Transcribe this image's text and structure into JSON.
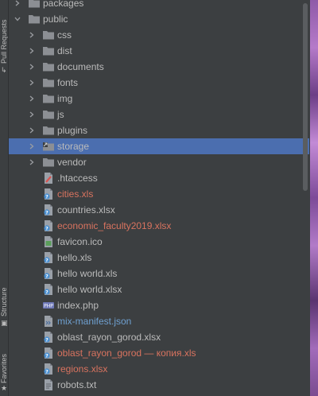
{
  "side_tabs": {
    "pull_requests": "Pull Requests",
    "structure": "Structure",
    "favorites": "Favorites"
  },
  "colors": {
    "panel_bg": "#3c3f41",
    "selection_bg": "#4b6eaf",
    "text_default": "#bbbbbb",
    "text_red": "#d9735f",
    "text_blue": "#6fa0d0",
    "folder": "#8c8f94"
  },
  "tree": {
    "selected": "storage",
    "items": [
      {
        "label": "packages",
        "kind": "folder",
        "arrow": "collapsed",
        "depth": 1,
        "color": "default"
      },
      {
        "label": "public",
        "kind": "folder",
        "arrow": "expanded",
        "depth": 1,
        "color": "default"
      },
      {
        "label": "css",
        "kind": "folder",
        "arrow": "collapsed",
        "depth": 2,
        "color": "default"
      },
      {
        "label": "dist",
        "kind": "folder",
        "arrow": "collapsed",
        "depth": 2,
        "color": "default"
      },
      {
        "label": "documents",
        "kind": "folder",
        "arrow": "collapsed",
        "depth": 2,
        "color": "default"
      },
      {
        "label": "fonts",
        "kind": "folder",
        "arrow": "collapsed",
        "depth": 2,
        "color": "default"
      },
      {
        "label": "img",
        "kind": "folder",
        "arrow": "collapsed",
        "depth": 2,
        "color": "default"
      },
      {
        "label": "js",
        "kind": "folder",
        "arrow": "collapsed",
        "depth": 2,
        "color": "default"
      },
      {
        "label": "plugins",
        "kind": "folder",
        "arrow": "collapsed",
        "depth": 2,
        "color": "default"
      },
      {
        "label": "storage",
        "kind": "folder-link",
        "arrow": "collapsed",
        "depth": 2,
        "color": "default",
        "selected": true
      },
      {
        "label": "vendor",
        "kind": "folder",
        "arrow": "collapsed",
        "depth": 2,
        "color": "default"
      },
      {
        "label": ".htaccess",
        "kind": "htaccess",
        "arrow": "none",
        "depth": 2,
        "color": "default"
      },
      {
        "label": "cities.xls",
        "kind": "unknown",
        "arrow": "none",
        "depth": 2,
        "color": "red"
      },
      {
        "label": "countries.xlsx",
        "kind": "unknown",
        "arrow": "none",
        "depth": 2,
        "color": "default"
      },
      {
        "label": "economic_faculty2019.xlsx",
        "kind": "unknown",
        "arrow": "none",
        "depth": 2,
        "color": "red"
      },
      {
        "label": "favicon.ico",
        "kind": "image",
        "arrow": "none",
        "depth": 2,
        "color": "default"
      },
      {
        "label": "hello.xls",
        "kind": "unknown",
        "arrow": "none",
        "depth": 2,
        "color": "default"
      },
      {
        "label": "hello world.xls",
        "kind": "unknown",
        "arrow": "none",
        "depth": 2,
        "color": "default"
      },
      {
        "label": "hello world.xlsx",
        "kind": "unknown",
        "arrow": "none",
        "depth": 2,
        "color": "default"
      },
      {
        "label": "index.php",
        "kind": "php",
        "arrow": "none",
        "depth": 2,
        "color": "default"
      },
      {
        "label": "mix-manifest.json",
        "kind": "json",
        "arrow": "none",
        "depth": 2,
        "color": "blue"
      },
      {
        "label": "oblast_rayon_gorod.xlsx",
        "kind": "unknown",
        "arrow": "none",
        "depth": 2,
        "color": "default"
      },
      {
        "label": "oblast_rayon_gorod — копия.xls",
        "kind": "unknown",
        "arrow": "none",
        "depth": 2,
        "color": "red"
      },
      {
        "label": "regions.xlsx",
        "kind": "unknown",
        "arrow": "none",
        "depth": 2,
        "color": "red"
      },
      {
        "label": "robots.txt",
        "kind": "text",
        "arrow": "none",
        "depth": 2,
        "color": "default"
      }
    ]
  }
}
